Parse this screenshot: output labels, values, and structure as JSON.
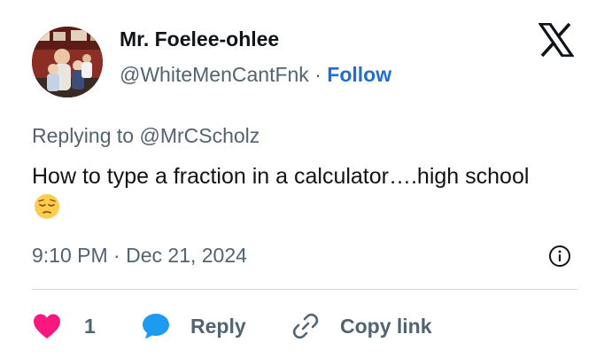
{
  "author": {
    "name": "Mr. Foelee-ohlee",
    "handle": "@WhiteMenCantFnk",
    "separator": "·",
    "follow_label": "Follow"
  },
  "tweet": {
    "replying_prefix": "Replying to ",
    "replying_to": "@MrCScholz",
    "text": "How to type a fraction in a calculator….high school",
    "emoji": "pensive-face",
    "time": "9:10 PM",
    "date_separator": "·",
    "date": "Dec 21, 2024"
  },
  "actions": {
    "like_count": "1",
    "reply_label": "Reply",
    "copy_link_label": "Copy link"
  },
  "colors": {
    "follow": "#1d6fd1",
    "like": "#f91880",
    "reply_bubble": "#1d9bf0",
    "secondary_text": "#536471"
  },
  "icons": [
    "x-logo-icon",
    "info-icon",
    "heart-icon",
    "reply-bubble-icon",
    "link-icon"
  ]
}
